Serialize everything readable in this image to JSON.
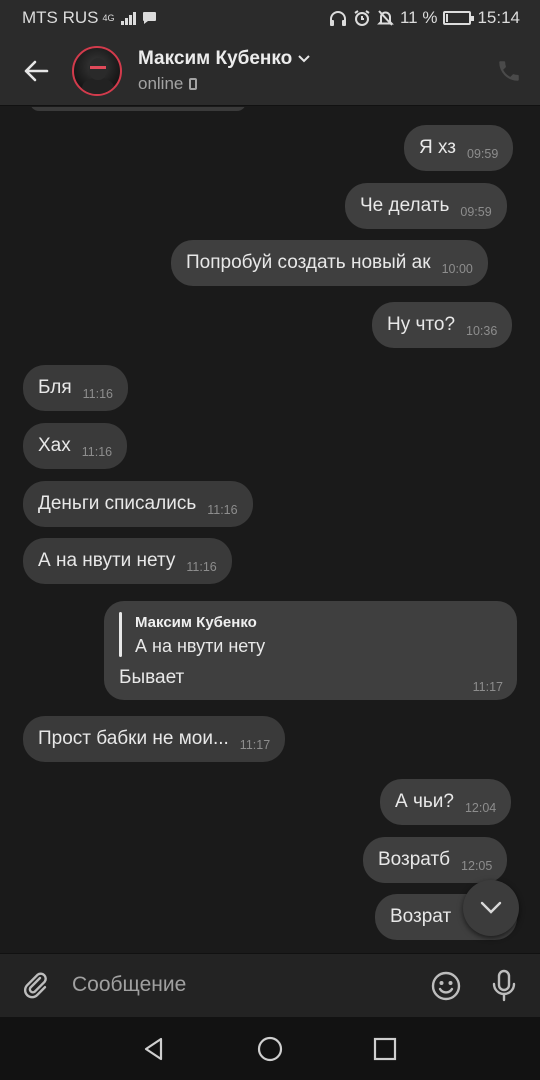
{
  "statusbar": {
    "carrier": "MTS RUS",
    "network": "4G",
    "battery_text": "11 %",
    "battery_level": 0.11,
    "time": "15:14"
  },
  "header": {
    "contact_name": "Максим Кубенко",
    "status": "online"
  },
  "messages": [
    {
      "text": "Я хз",
      "time": "09:59",
      "dir": "out"
    },
    {
      "text": "Че делать",
      "time": "09:59",
      "dir": "out"
    },
    {
      "text": "Попробуй создать новый ак",
      "time": "10:00",
      "dir": "out"
    },
    {
      "text": "Ну что?",
      "time": "10:36",
      "dir": "out"
    },
    {
      "text": "Бля",
      "time": "11:16",
      "dir": "in"
    },
    {
      "text": "Хах",
      "time": "11:16",
      "dir": "in"
    },
    {
      "text": "Деньги списались",
      "time": "11:16",
      "dir": "in"
    },
    {
      "text": "А на нвути нету",
      "time": "11:16",
      "dir": "in"
    },
    {
      "text": "Бывает",
      "time": "11:17",
      "dir": "out",
      "reply_to": {
        "name": "Максим Кубенко",
        "text": "А на нвути нету"
      }
    },
    {
      "text": "Прост бабки не мои...",
      "time": "11:17",
      "dir": "in"
    },
    {
      "text": "А чьи?",
      "time": "12:04",
      "dir": "out"
    },
    {
      "text": "Возратб",
      "time": "12:05",
      "dir": "out"
    },
    {
      "text": "Возрат",
      "time": "",
      "dir": "out"
    }
  ],
  "composer": {
    "placeholder": "Сообщение"
  },
  "icons": {
    "back": "arrow-left-icon",
    "call": "phone-icon",
    "attach": "paperclip-icon",
    "emoji": "smiley-icon",
    "mic": "microphone-icon",
    "scroll": "chevron-down-icon"
  },
  "colors": {
    "background": "#1a1a1a",
    "bubble": "#3a3a3a",
    "avatar_ring": "#d23b4c"
  }
}
